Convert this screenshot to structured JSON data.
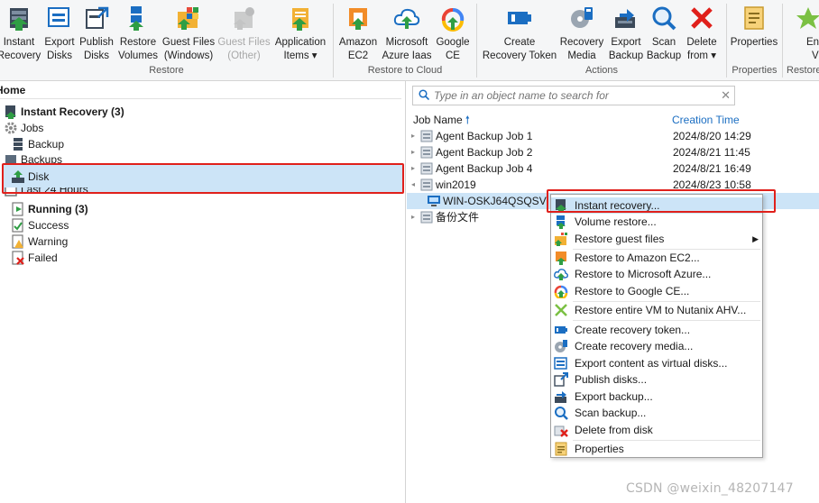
{
  "ribbon": {
    "buttons": [
      {
        "line1": "Instant",
        "line2": "Recovery",
        "icon": "instant-recovery-icon"
      },
      {
        "line1": "Export",
        "line2": "Disks",
        "icon": "export-disks-icon"
      },
      {
        "line1": "Publish",
        "line2": "Disks",
        "icon": "publish-disks-icon"
      },
      {
        "line1": "Restore",
        "line2": "Volumes",
        "icon": "restore-volumes-icon"
      },
      {
        "line1": "Guest Files",
        "line2": "(Windows)",
        "icon": "guest-files-windows-icon"
      },
      {
        "line1": "Guest Files",
        "line2": "(Other)",
        "icon": "guest-files-other-icon"
      },
      {
        "line1": "Application",
        "line2": "Items ▾",
        "icon": "application-items-icon"
      },
      {
        "line1": "Amazon",
        "line2": "EC2",
        "icon": "amazon-ec2-icon"
      },
      {
        "line1": "Microsoft",
        "line2": "Azure Iaas",
        "icon": "microsoft-azure-icon"
      },
      {
        "line1": "Google",
        "line2": "CE",
        "icon": "google-ce-icon"
      },
      {
        "line1": "Create",
        "line2": "Recovery Token",
        "icon": "recovery-token-icon"
      },
      {
        "line1": "Recovery",
        "line2": "Media",
        "icon": "recovery-media-icon"
      },
      {
        "line1": "Export",
        "line2": "Backup",
        "icon": "export-backup-icon"
      },
      {
        "line1": "Scan",
        "line2": "Backup",
        "icon": "scan-backup-icon"
      },
      {
        "line1": "Delete",
        "line2": "from ▾",
        "icon": "delete-icon"
      },
      {
        "line1": "Properties",
        "line2": "",
        "icon": "properties-icon"
      },
      {
        "line1": "Ent",
        "line2": "V",
        "icon": "entire-vm-icon"
      }
    ],
    "groups": [
      "Restore",
      "Restore to Cloud",
      "Actions",
      "Properties",
      "Restore"
    ]
  },
  "left": {
    "home": "Home",
    "tree": [
      {
        "label": "Instant Recovery (3)",
        "bold": true,
        "icon": "instant-recovery-icon"
      },
      {
        "label": "Jobs",
        "bold": false,
        "icon": "jobs-gear-icon"
      },
      {
        "label": "Backup",
        "bold": false,
        "icon": "backup-job-icon"
      },
      {
        "label": "Backups",
        "bold": false,
        "icon": "backups-icon"
      },
      {
        "label": "Disk",
        "bold": false,
        "icon": "disk-icon"
      },
      {
        "label": "Last 24 Hours",
        "bold": false,
        "icon": "last-24-hours-icon"
      },
      {
        "label": "Running (3)",
        "bold": true,
        "icon": "running-icon"
      },
      {
        "label": "Success",
        "bold": false,
        "icon": "success-icon"
      },
      {
        "label": "Warning",
        "bold": false,
        "icon": "warning-icon"
      },
      {
        "label": "Failed",
        "bold": false,
        "icon": "failed-icon"
      }
    ]
  },
  "right": {
    "search_placeholder": "Type in an object name to search for",
    "col_job": "Job Name",
    "col_time": "Creation Time",
    "rows": [
      {
        "name": "Agent Backup Job 1",
        "time": "2024/8/20 14:29"
      },
      {
        "name": "Agent Backup Job 2",
        "time": "2024/8/21 11:45"
      },
      {
        "name": "Agent Backup Job 4",
        "time": "2024/8/21 16:49"
      },
      {
        "name": "win2019",
        "time": "2024/8/23 10:58"
      },
      {
        "name": "WIN-OSKJ64QSQSV",
        "time": ""
      },
      {
        "name": "备份文件",
        "time": ""
      }
    ]
  },
  "context_menu": {
    "items": [
      {
        "label": "Instant recovery...",
        "icon": "instant-recovery-icon"
      },
      {
        "label": "Volume restore...",
        "icon": "volume-restore-icon"
      },
      {
        "label": "Restore guest files",
        "icon": "restore-guest-files-icon"
      },
      {
        "label": "Restore to Amazon EC2...",
        "icon": "amazon-ec2-icon"
      },
      {
        "label": "Restore to Microsoft Azure...",
        "icon": "microsoft-azure-icon"
      },
      {
        "label": "Restore to Google CE...",
        "icon": "google-ce-icon"
      },
      {
        "label": "Restore entire VM to Nutanix AHV...",
        "icon": "nutanix-icon"
      },
      {
        "label": "Create recovery token...",
        "icon": "recovery-token-icon"
      },
      {
        "label": "Create recovery media...",
        "icon": "recovery-media-icon"
      },
      {
        "label": "Export content as virtual disks...",
        "icon": "export-disks-icon"
      },
      {
        "label": "Publish disks...",
        "icon": "publish-disks-icon"
      },
      {
        "label": "Export backup...",
        "icon": "export-backup-icon"
      },
      {
        "label": "Scan backup...",
        "icon": "scan-backup-icon"
      },
      {
        "label": "Delete from disk",
        "icon": "delete-icon"
      },
      {
        "label": "Properties",
        "icon": "properties-icon"
      }
    ]
  },
  "watermark": "CSDN @weixin_48207147",
  "colors": {
    "accent": "#1b6ec2",
    "selection": "#cce4f7",
    "highlight_box": "#e0201b"
  }
}
